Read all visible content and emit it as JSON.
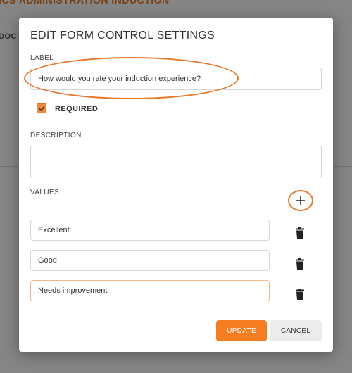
{
  "background": {
    "page_title": "ICS ADMINISTRATION INDUCTION",
    "tab_label": "DOC"
  },
  "modal": {
    "title": "EDIT FORM CONTROL SETTINGS",
    "label_field": {
      "label": "LABEL",
      "value": "How would you rate your induction experience?"
    },
    "required": {
      "label": "REQUIRED",
      "checked": true
    },
    "description_field": {
      "label": "DESCRIPTION",
      "value": ""
    },
    "values_section": {
      "label": "VALUES",
      "add_icon": "plus-icon",
      "items": [
        {
          "value": "Excellent"
        },
        {
          "value": "Good"
        },
        {
          "value": "Needs improvement"
        }
      ],
      "delete_icon": "trash-icon"
    },
    "buttons": {
      "update": "UPDATE",
      "cancel": "CANCEL"
    }
  },
  "colors": {
    "accent": "#f57c20",
    "highlight": "#e8792a"
  }
}
